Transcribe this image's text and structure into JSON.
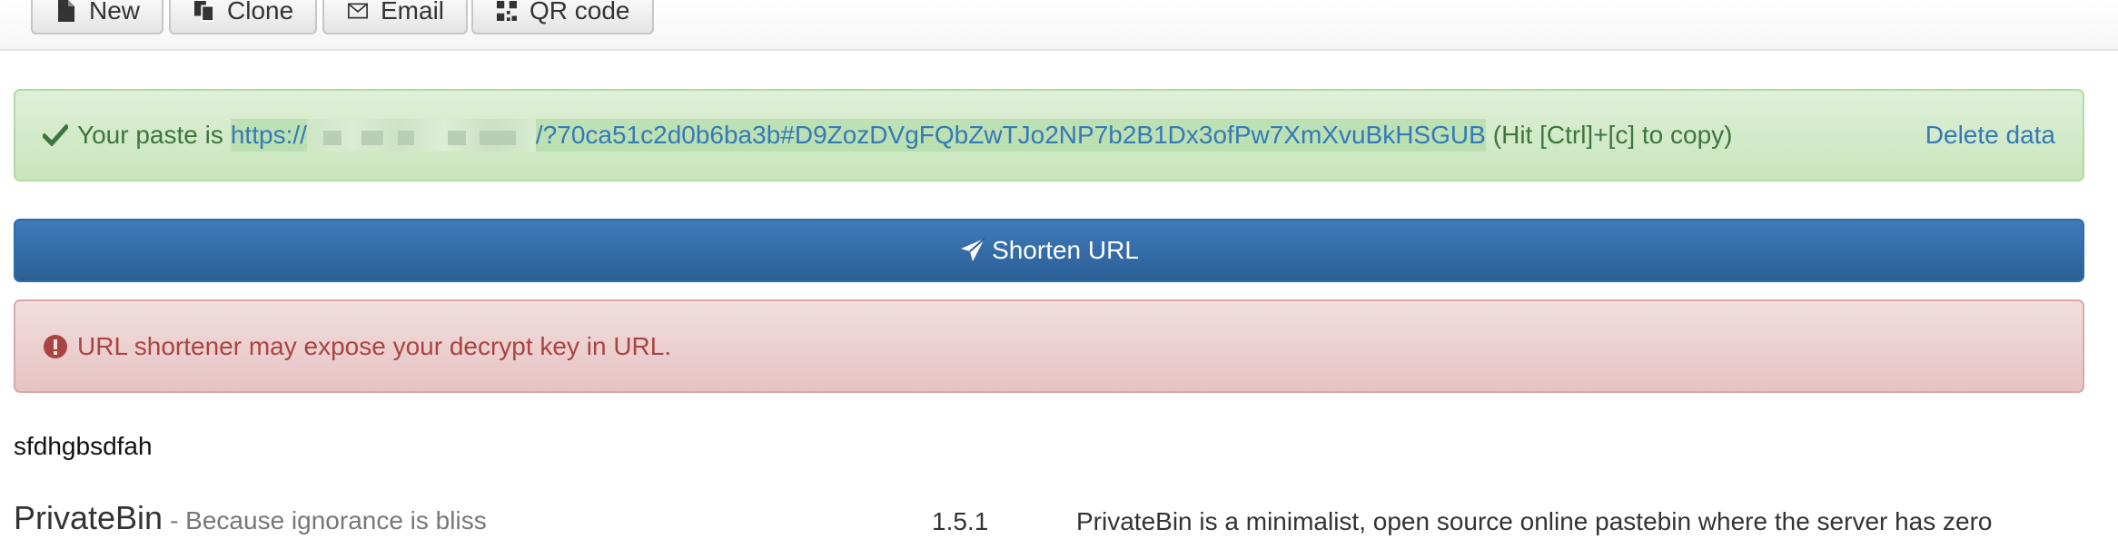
{
  "navbar": {
    "buttons": [
      {
        "label": "New",
        "icon": "file-icon"
      },
      {
        "label": "Clone",
        "icon": "duplicate-icon"
      },
      {
        "label": "Email",
        "icon": "envelope-icon"
      },
      {
        "label": "QR code",
        "icon": "qrcode-icon"
      }
    ]
  },
  "success_alert": {
    "icon": "checkmark-icon",
    "prefix": "Your paste is",
    "url_start": "https://",
    "url_end": "/?70ca51c2d0b6ba3b#D9ZozDVgFQbZwTJo2NP7b2B1Dx3ofPw7XmXvuBkHSGUB",
    "copy_hint": "(Hit [Ctrl]+[c] to copy)",
    "delete_label": "Delete data"
  },
  "shorten": {
    "label": "Shorten URL",
    "icon": "send-icon"
  },
  "warning_alert": {
    "icon": "exclamation-circle-icon",
    "text": "URL shortener may expose your decrypt key in URL."
  },
  "paste": {
    "content": "sfdhgbsdfah"
  },
  "footer": {
    "brand": "PrivateBin",
    "tagline": "- Because ignorance is bliss",
    "version": "1.5.1",
    "description": "PrivateBin is a minimalist, open source online pastebin where the server has zero"
  },
  "colors": {
    "link": "#337ab7",
    "success_text": "#3c763d",
    "danger_text": "#a94442",
    "primary_button": "#337ab7"
  }
}
